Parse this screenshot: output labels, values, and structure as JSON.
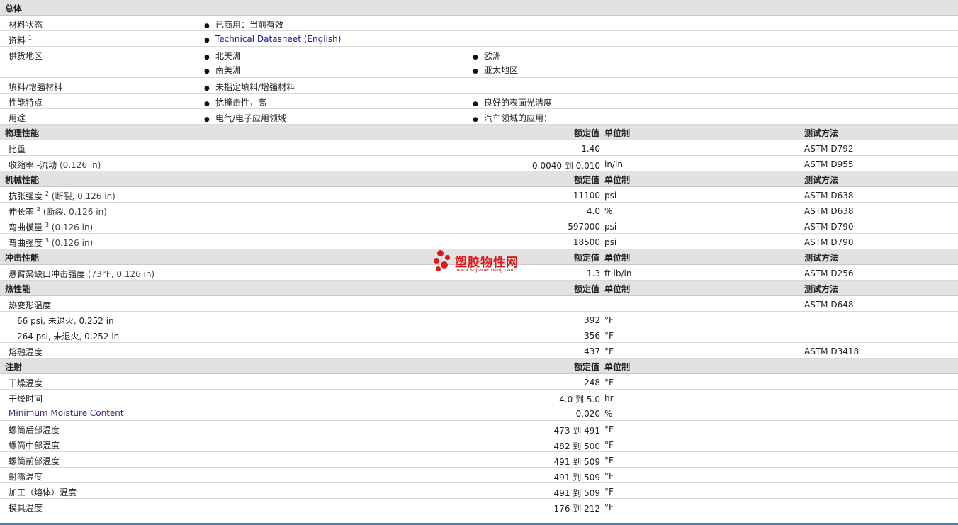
{
  "sections": {
    "general": {
      "title": "总体"
    },
    "physical": {
      "title": "物理性能",
      "col_value": "额定值",
      "col_unit": "单位制",
      "col_test": "测试方法"
    },
    "mechanical": {
      "title": "机械性能",
      "col_value": "额定值",
      "col_unit": "单位制",
      "col_test": "测试方法"
    },
    "impact": {
      "title": "冲击性能",
      "col_value": "额定值",
      "col_unit": "单位制",
      "col_test": "测试方法"
    },
    "thermal": {
      "title": "热性能",
      "col_value": "额定值",
      "col_unit": "单位制",
      "col_test": "测试方法"
    },
    "injection": {
      "title": "注射",
      "col_value": "额定值",
      "col_unit": "单位制"
    }
  },
  "general": {
    "status_label": "材料状态",
    "status_value": "已商用：当前有效",
    "docs_label": "资料",
    "docs_sup": "1",
    "docs_link": "Technical Datasheet (English)",
    "region_label": "供货地区",
    "region_1": "北美洲",
    "region_2": "欧洲",
    "region_3": "南美洲",
    "region_4": "亚太地区",
    "filler_label": "填料/增强材料",
    "filler_value": "未指定填料/增强材料",
    "features_label": "性能特点",
    "feature_1": "抗撞击性，高",
    "feature_2": "良好的表面光洁度",
    "uses_label": "用途",
    "use_1": "电气/电子应用领域",
    "use_2": "汽车领域的应用："
  },
  "physical": {
    "sg_label": "比重",
    "sg_value": "1.40",
    "sg_test": "ASTM D792",
    "shrink_label": "收缩率 -流动",
    "shrink_cond": "(0.126 in)",
    "shrink_value": "0.0040 到  0.010",
    "shrink_unit": "in/in",
    "shrink_test": "ASTM D955"
  },
  "mechanical": {
    "ts_label": "抗张强度",
    "ts_sup": "2",
    "ts_cond": "(断裂, 0.126 in)",
    "ts_value": "11100",
    "ts_unit": "psi",
    "ts_test": "ASTM D638",
    "el_label": "伸长率",
    "el_sup": "2",
    "el_cond": "(断裂, 0.126 in)",
    "el_value": "4.0",
    "el_unit": "%",
    "el_test": "ASTM D638",
    "fm_label": "弯曲模量",
    "fm_sup": "3",
    "fm_cond": "(0.126 in)",
    "fm_value": "597000",
    "fm_unit": "psi",
    "fm_test": "ASTM D790",
    "fs_label": "弯曲强度",
    "fs_sup": "3",
    "fs_cond": "(0.126 in)",
    "fs_value": "18500",
    "fs_unit": "psi",
    "fs_test": "ASTM D790"
  },
  "impact": {
    "izod_label": "悬臂梁缺口冲击强度",
    "izod_cond": "(73°F, 0.126 in)",
    "izod_value": "1.3",
    "izod_unit": "ft·lb/in",
    "izod_test": "ASTM D256"
  },
  "thermal": {
    "hdt_label": "热变形温度",
    "hdt_test": "ASTM D648",
    "hdt66_label": "66 psi, 未退火, 0.252 in",
    "hdt66_value": "392",
    "hdt66_unit": "°F",
    "hdt264_label": "264 psi, 未退火, 0.252 in",
    "hdt264_value": "356",
    "hdt264_unit": "°F",
    "melt_label": "熔融温度",
    "melt_value": "437",
    "melt_unit": "°F",
    "melt_test": "ASTM D3418"
  },
  "injection": {
    "dry_temp_label": "干燥温度",
    "dry_temp_value": "248",
    "dry_temp_unit": "°F",
    "dry_time_label": "干燥时间",
    "dry_time_value": "4.0 到  5.0",
    "dry_time_unit": "hr",
    "moist_label": "Minimum Moisture Content",
    "moist_value": "0.020",
    "moist_unit": "%",
    "rear_label": "螺筒后部温度",
    "rear_value": "473 到  491",
    "rear_unit": "°F",
    "mid_label": "螺筒中部温度",
    "mid_value": "482 到  500",
    "mid_unit": "°F",
    "front_label": "螺筒前部温度",
    "front_value": "491 到  509",
    "front_unit": "°F",
    "nozzle_label": "射嘴温度",
    "nozzle_value": "491 到  509",
    "nozzle_unit": "°F",
    "melt_label": "加工（熔体）温度",
    "melt_value": "491 到  509",
    "melt_unit": "°F",
    "mold_label": "模具温度",
    "mold_value": "176 到  212",
    "mold_unit": "°F"
  },
  "watermark": {
    "name": "塑胶物性网",
    "url": "www.sujiaowuxing.com"
  },
  "colors": {
    "header_bg": "#e2e2e2",
    "link": "#1a1a9a",
    "watermark": "#e1161b",
    "purple_label": "#4b2270"
  }
}
